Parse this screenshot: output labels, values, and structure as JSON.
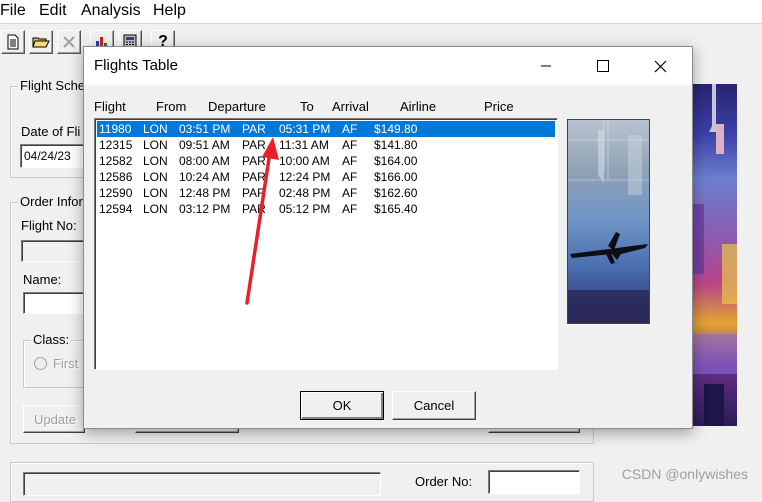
{
  "menu": [
    "File",
    "Edit",
    "Analysis",
    "Help"
  ],
  "toolbar": {
    "icons": [
      "new-document-icon",
      "open-folder-icon",
      "delete-icon",
      "chart-icon",
      "calculator-icon",
      "help-icon"
    ],
    "help_glyph": "?"
  },
  "main": {
    "schedule_group": "Flight Sche",
    "date_label": "Date of Fli",
    "date_value": "04/24/23",
    "order_group": "Order Infor",
    "flight_no_label": "Flight No:",
    "name_label": "Name:",
    "class_group": "Class:",
    "first_label": "First",
    "update_button": "Update",
    "order_no_label": "Order No:"
  },
  "dialog": {
    "title": "Flights Table",
    "columns": [
      "Flight",
      "From",
      "Departure",
      "To",
      "Arrival",
      "Airline",
      "Price"
    ],
    "rows": [
      {
        "flight": "11980",
        "from": "LON",
        "departure": "03:51 PM",
        "to": "PAR",
        "arrival": "05:31 PM",
        "airline": "AF",
        "price": "$149.80",
        "selected": true
      },
      {
        "flight": "12315",
        "from": "LON",
        "departure": "09:51 AM",
        "to": "PAR",
        "arrival": "11:31 AM",
        "airline": "AF",
        "price": "$141.80",
        "selected": false
      },
      {
        "flight": "12582",
        "from": "LON",
        "departure": "08:00 AM",
        "to": "PAR",
        "arrival": "10:00 AM",
        "airline": "AF",
        "price": "$164.00",
        "selected": false
      },
      {
        "flight": "12586",
        "from": "LON",
        "departure": "10:24 AM",
        "to": "PAR",
        "arrival": "12:24 PM",
        "airline": "AF",
        "price": "$166.00",
        "selected": false
      },
      {
        "flight": "12590",
        "from": "LON",
        "departure": "12:48 PM",
        "to": "PAR",
        "arrival": "02:48 PM",
        "airline": "AF",
        "price": "$162.60",
        "selected": false
      },
      {
        "flight": "12594",
        "from": "LON",
        "departure": "03:12 PM",
        "to": "PAR",
        "arrival": "05:12 PM",
        "airline": "AF",
        "price": "$165.40",
        "selected": false
      }
    ],
    "ok_label": "OK",
    "cancel_label": "Cancel",
    "selection_color": "#0078d7"
  },
  "annotation": {
    "color": "#e8202a"
  },
  "watermark": "CSDN @onlywishes"
}
